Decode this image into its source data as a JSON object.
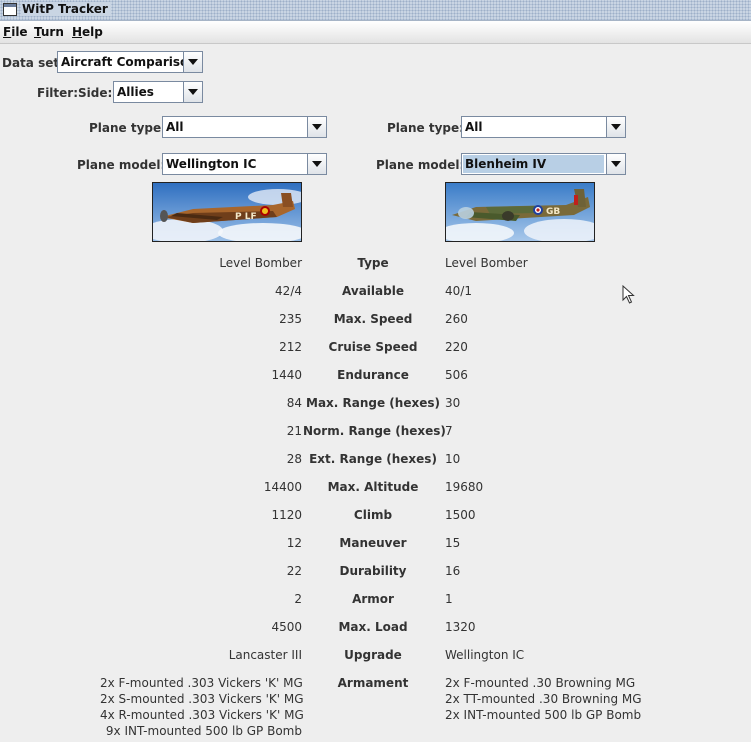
{
  "window": {
    "title": "WitP Tracker"
  },
  "menu": [
    {
      "label": "File",
      "mnemonic": "F",
      "rest": "ile"
    },
    {
      "label": "Turn",
      "mnemonic": "T",
      "rest": "urn"
    },
    {
      "label": "Help",
      "mnemonic": "H",
      "rest": "elp"
    }
  ],
  "controls": {
    "dataset_label": "Data set:",
    "dataset_value": "Aircraft Comparison",
    "filter_label": "Filter:",
    "side_label": "Side:",
    "side_value": "Allies",
    "left": {
      "plane_type_label": "Plane type:",
      "plane_type_value": "All",
      "plane_model_label": "Plane model:",
      "plane_model_value": "Wellington IC"
    },
    "right": {
      "plane_type_label": "Plane type:",
      "plane_type_value": "All",
      "plane_model_label": "Plane model:",
      "plane_model_value": "Blenheim IV"
    }
  },
  "images": {
    "left": {
      "markings": "P LF"
    },
    "right": {
      "markings": "GB"
    }
  },
  "comparison": [
    {
      "label": "Type",
      "left": "Level Bomber",
      "right": "Level Bomber"
    },
    {
      "label": "Available",
      "left": "42/4",
      "right": "40/1"
    },
    {
      "label": "Max. Speed",
      "left": "235",
      "right": "260"
    },
    {
      "label": "Cruise Speed",
      "left": "212",
      "right": "220"
    },
    {
      "label": "Endurance",
      "left": "1440",
      "right": "506"
    },
    {
      "label": "Max. Range (hexes)",
      "left": "84",
      "right": "30"
    },
    {
      "label": "Norm. Range (hexes)",
      "left": "21",
      "right": "7"
    },
    {
      "label": "Ext. Range (hexes)",
      "left": "28",
      "right": "10"
    },
    {
      "label": "Max. Altitude",
      "left": "14400",
      "right": "19680"
    },
    {
      "label": "Climb",
      "left": "1120",
      "right": "1500"
    },
    {
      "label": "Maneuver",
      "left": "12",
      "right": "15"
    },
    {
      "label": "Durability",
      "left": "22",
      "right": "16"
    },
    {
      "label": "Armor",
      "left": "2",
      "right": "1"
    },
    {
      "label": "Max. Load",
      "left": "4500",
      "right": "1320"
    },
    {
      "label": "Upgrade",
      "left": "Lancaster III",
      "right": "Wellington IC"
    }
  ],
  "armament": {
    "label": "Armament",
    "left": [
      "2x F-mounted .303 Vickers 'K' MG",
      "2x S-mounted .303 Vickers 'K' MG",
      "4x R-mounted .303 Vickers 'K' MG",
      "9x INT-mounted 500 lb GP Bomb"
    ],
    "right": [
      "2x F-mounted .30 Browning MG",
      "2x TT-mounted .30 Browning MG",
      "2x INT-mounted 500 lb GP Bomb"
    ]
  }
}
